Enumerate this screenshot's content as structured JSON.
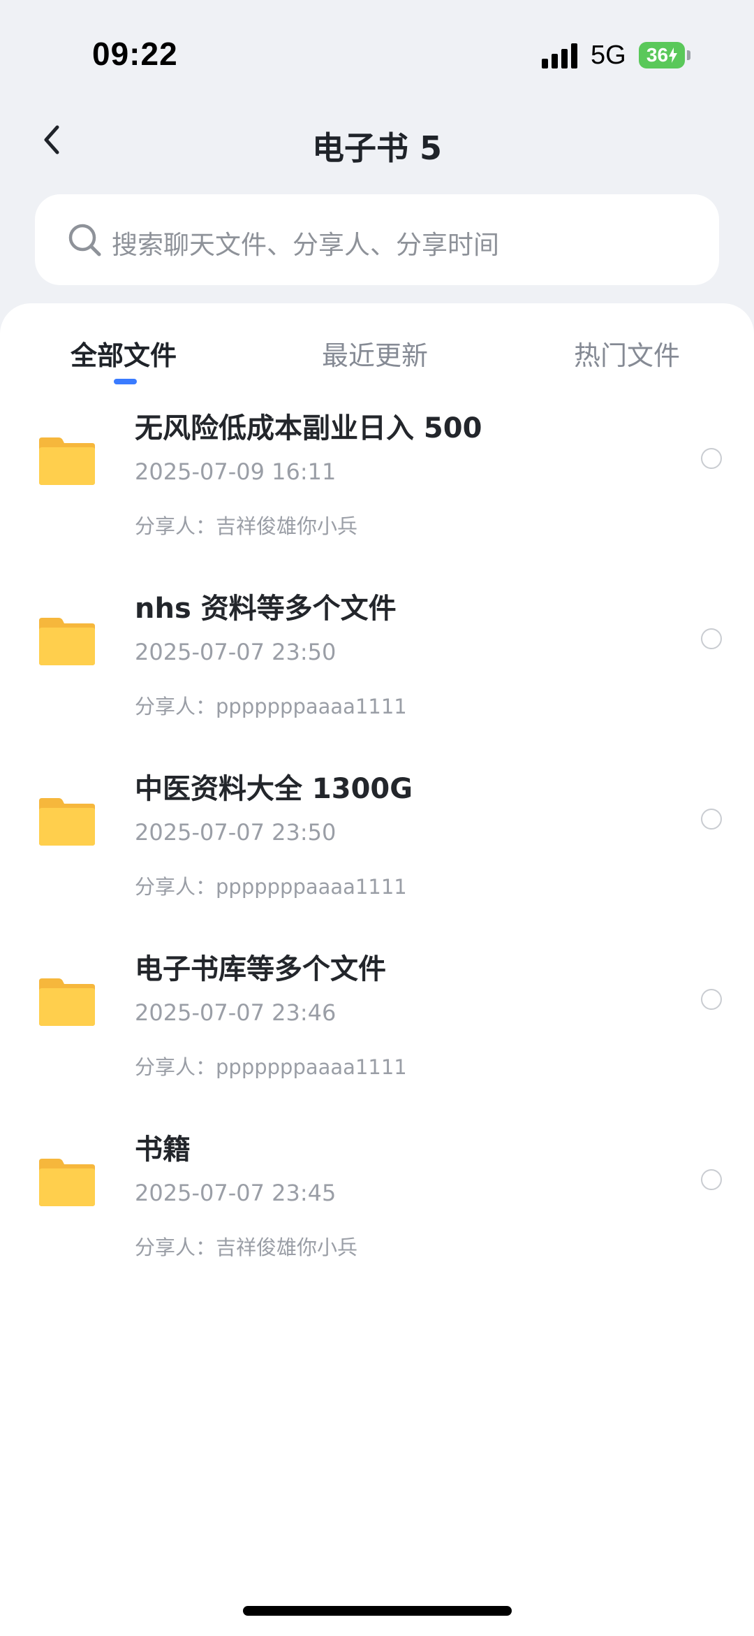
{
  "status_bar": {
    "time": "09:22",
    "network": "5G",
    "battery": "36",
    "icons": [
      "signal-icon",
      "battery-charging-icon"
    ]
  },
  "header": {
    "title": "电子书 5",
    "back_icon": "chevron-left-icon"
  },
  "search": {
    "placeholder": "搜索聊天文件、分享人、分享时间",
    "icon": "search-icon"
  },
  "tabs": [
    {
      "label": "全部文件",
      "active": true
    },
    {
      "label": "最近更新",
      "active": false
    },
    {
      "label": "热门文件",
      "active": false
    }
  ],
  "colors": {
    "accent": "#3A7BFF",
    "folder": "#FFCF4D",
    "battery": "#5AC85A",
    "background": "#EFF1F5"
  },
  "files": [
    {
      "name": "无风险低成本副业日入 500",
      "date": "2025-07-09 16:11",
      "sharer": "分享人：吉祥俊雄你小兵",
      "icon": "folder-icon"
    },
    {
      "name": "nhs 资料等多个文件",
      "date": "2025-07-07 23:50",
      "sharer": "分享人：pppppppaaaa1111",
      "icon": "folder-icon"
    },
    {
      "name": "中医资料大全 1300G",
      "date": "2025-07-07 23:50",
      "sharer": "分享人：pppppppaaaa1111",
      "icon": "folder-icon"
    },
    {
      "name": "电子书库等多个文件",
      "date": "2025-07-07 23:46",
      "sharer": "分享人：pppppppaaaa1111",
      "icon": "folder-icon"
    },
    {
      "name": "书籍",
      "date": "2025-07-07 23:45",
      "sharer": "分享人：吉祥俊雄你小兵",
      "icon": "folder-icon"
    }
  ]
}
